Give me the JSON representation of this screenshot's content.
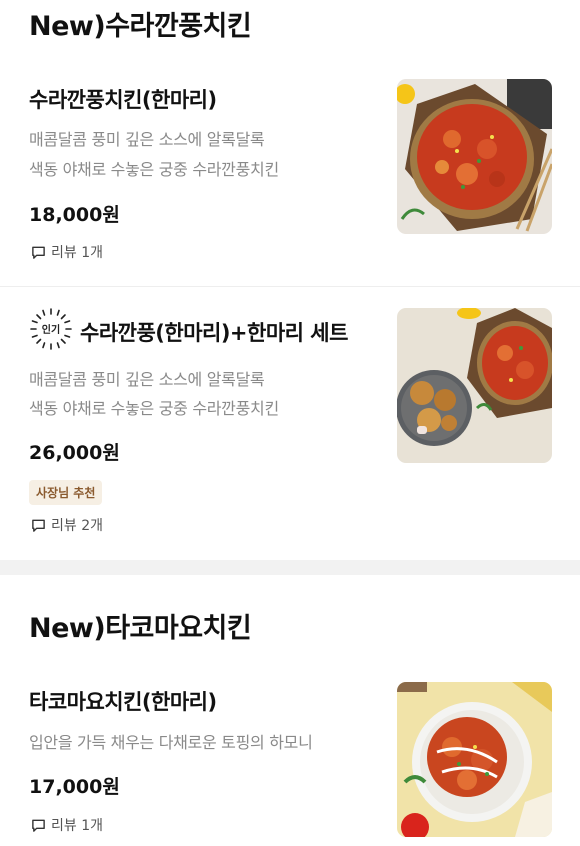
{
  "sections": [
    {
      "title": "New)수라깐풍치킨",
      "items": [
        {
          "name": "수라깐풍치킨(한마리)",
          "desc_line1": "매콤달콤 풍미 깊은 소스에 알록달록",
          "desc_line2": "색동 야채로 수놓은 궁중 수라깐풍치킨",
          "price": "18,000원",
          "review": "리뷰 1개"
        },
        {
          "popular_label": "인기",
          "name": "수라깐풍(한마리)+한마리 세트",
          "desc_line1": "매콤달콤 풍미 깊은 소스에 알록달록",
          "desc_line2": "색동 야채로 수놓은 궁중 수라깐풍치킨",
          "price": "26,000원",
          "badge": "사장님 추천",
          "review": "리뷰 2개"
        }
      ]
    },
    {
      "title": "New)타코마요치킨",
      "items": [
        {
          "name": "타코마요치킨(한마리)",
          "desc_line1": "입안을 가득 채우는 다채로운 토핑의 하모니",
          "price": "17,000원",
          "review": "리뷰 1개"
        }
      ]
    }
  ],
  "icons": {
    "review": "speech-bubble-icon",
    "popular": "sunburst-popular-icon"
  },
  "colors": {
    "badge_bg": "#f6efe4",
    "badge_text": "#8a5a2e",
    "price": "#111111",
    "desc": "#8a8a8a"
  }
}
